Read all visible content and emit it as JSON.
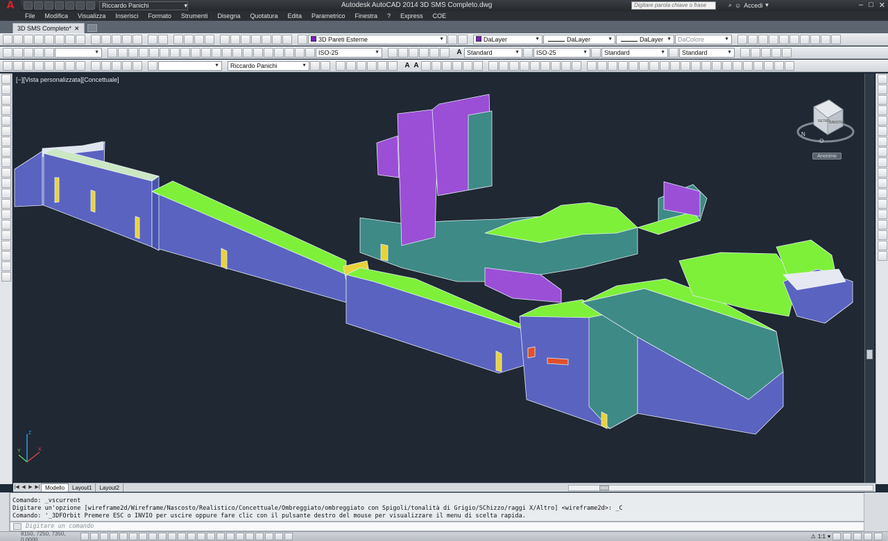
{
  "app": {
    "title": "Autodesk AutoCAD 2014   3D SMS Completo.dwg",
    "logo_letter": "A",
    "workspace": "Riccardo Panichi",
    "search_placeholder": "Digitare parola chiave o frase",
    "signin_label": "Accedi",
    "window_buttons": [
      "–",
      "□",
      "✕"
    ]
  },
  "menu": {
    "items": [
      "File",
      "Modifica",
      "Visualizza",
      "Inserisci",
      "Formato",
      "Strumenti",
      "Disegna",
      "Quotatura",
      "Edita",
      "Parametrico",
      "Finestra",
      "?",
      "Express",
      "COE"
    ]
  },
  "tabs": {
    "document": "3D SMS Completo*",
    "close_glyph": "✕"
  },
  "toolbar1": {
    "layer": "3D Pareti Esterne",
    "color": "DaLayer",
    "linetype": "DaLayer",
    "lineweight": "DaLayer",
    "plotstyle": "DaColore",
    "layer_color": "#7a1fc8"
  },
  "toolbar2": {
    "dimstyle": "ISO-25",
    "textstyle": "Standard",
    "dimstyle2": "ISO-25",
    "tablestyle": "Standard",
    "mleaderstyle": "Standard"
  },
  "toolbar3": {
    "user": "Riccardo Panichi"
  },
  "viewport": {
    "label": "[−][Vista personalizzata][Concettuale]",
    "viewcube_top": "RETRO",
    "viewcube_side": "SINISTRA",
    "compass_letters": [
      "N",
      "O"
    ],
    "ucs_button": "Anonimo",
    "ucs_axes": [
      "X",
      "Y",
      "Z"
    ]
  },
  "layout_tabs": {
    "nav": [
      "|◀",
      "◀",
      "▶",
      "▶|"
    ],
    "items": [
      "Modello",
      "Layout1",
      "Layout2"
    ],
    "active": "Modello"
  },
  "command": {
    "history": [
      "Comando: _vscurrent",
      "Digitare un'opzione [wireframe2d/Wireframe/Nascosto/Realistico/Concettuale/Ombreggiato/ombreggiato con Spigoli/tonalità di Grigio/SChizzo/raggi X/Altro] <wireframe2d>: _C",
      "Comando: '_3DFOrbit Premere ESC o INVIO per uscire oppure fare clic con il pulsante destro del mouse per visualizzare il menu di scelta rapida."
    ],
    "input_placeholder": "Digitare un comando"
  },
  "status": {
    "coordinates": "8150, 7250, 7350, 0.0000",
    "scale": "1:1"
  },
  "colors": {
    "viewport_bg": "#1f2833",
    "wall_blue": "#5a63c0",
    "roof_green": "#7ef03a",
    "purple": "#9b4fd6",
    "teal": "#3e8a86",
    "yellow": "#e8d33a"
  }
}
